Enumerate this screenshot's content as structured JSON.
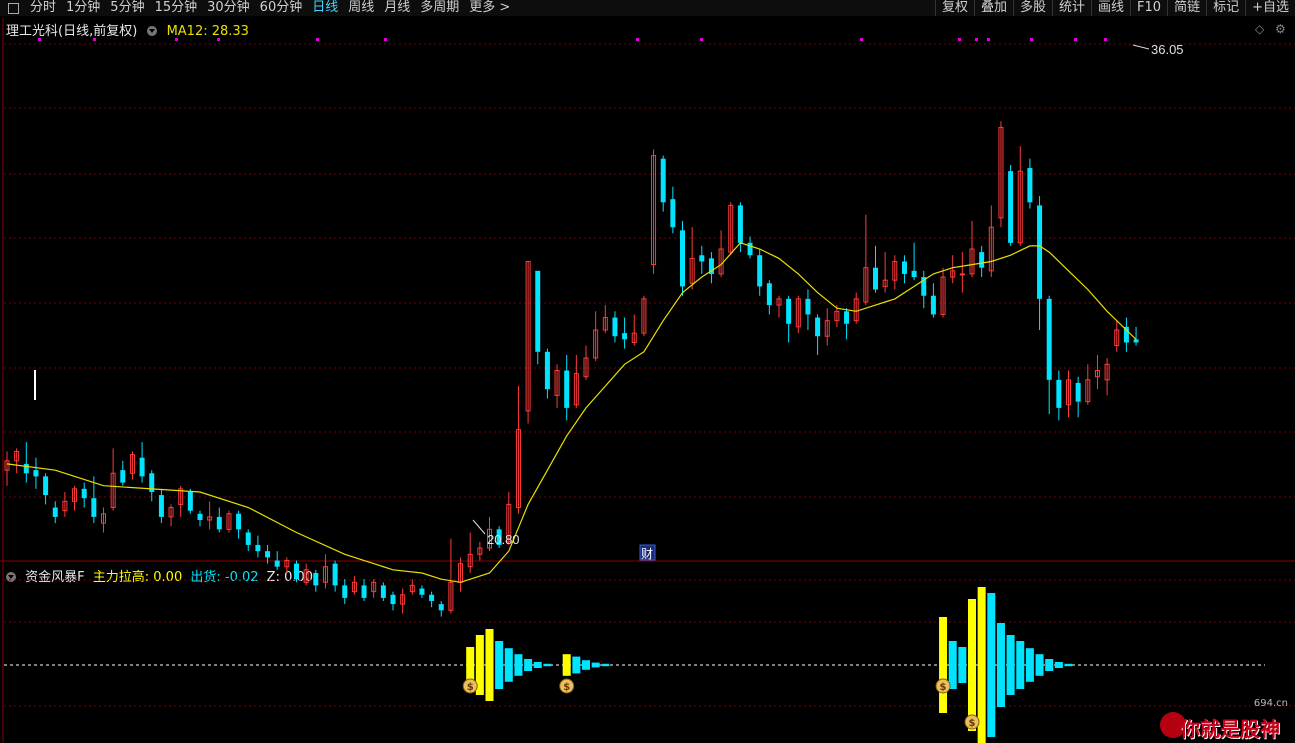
{
  "toolbar": {
    "periods": [
      "分时",
      "1分钟",
      "5分钟",
      "15分钟",
      "30分钟",
      "60分钟",
      "日线",
      "周线",
      "月线",
      "多周期",
      "更多 >"
    ],
    "active_period": "日线",
    "right_buttons": [
      "复权",
      "叠加",
      "多股",
      "统计",
      "画线",
      "F10",
      "简链",
      "标记",
      "+自选"
    ]
  },
  "main_chart": {
    "stock_title": "理工光科(日线,前复权)",
    "ma_label": "MA12: 28.33",
    "high_mark": "36.05",
    "low_mark": "20.80",
    "event_badge": "财"
  },
  "indicator": {
    "name": "资金风暴F",
    "l1": "主力拉高: 0.00",
    "l2": "出货: -0.02",
    "l3": "Z: 0.00"
  },
  "watermark": {
    "site": "694.cn",
    "text": "你就是股神"
  },
  "colors": {
    "up": "#ff3b3b",
    "down": "#00e4ff",
    "ma": "#e8e000",
    "grid": "#7a0000",
    "yellow": "#ffff00",
    "cyan": "#00e4ff"
  },
  "chart_data": {
    "type": "candlestick",
    "y_high": 36.05,
    "y_low": 20.8,
    "ma12_last": 28.33,
    "candles": [
      [
        0,
        22.4,
        22.7,
        21.9,
        23.0
      ],
      [
        1,
        22.7,
        23.0,
        22.3,
        23.1
      ],
      [
        2,
        22.6,
        22.3,
        22.0,
        23.3
      ],
      [
        3,
        22.4,
        22.2,
        21.8,
        22.8
      ],
      [
        4,
        22.2,
        21.6,
        21.3,
        22.3
      ],
      [
        5,
        21.2,
        20.9,
        20.7,
        21.4
      ],
      [
        6,
        21.1,
        21.4,
        20.9,
        21.7
      ],
      [
        7,
        21.4,
        21.8,
        21.1,
        21.9
      ],
      [
        8,
        21.8,
        21.5,
        21.2,
        22.0
      ],
      [
        9,
        21.5,
        20.9,
        20.7,
        22.2
      ],
      [
        10,
        20.7,
        21.0,
        20.4,
        21.2
      ],
      [
        11,
        21.2,
        22.3,
        21.1,
        23.1
      ],
      [
        12,
        22.4,
        22.0,
        21.9,
        22.7
      ],
      [
        13,
        22.3,
        22.9,
        22.1,
        23.0
      ],
      [
        14,
        22.8,
        22.2,
        22.0,
        23.3
      ],
      [
        15,
        22.3,
        21.7,
        21.4,
        22.4
      ],
      [
        16,
        21.6,
        20.9,
        20.7,
        21.8
      ],
      [
        17,
        20.9,
        21.2,
        20.6,
        21.3
      ],
      [
        18,
        21.3,
        21.8,
        20.9,
        21.9
      ],
      [
        19,
        21.7,
        21.1,
        21.0,
        21.8
      ],
      [
        20,
        21.0,
        20.8,
        20.6,
        21.1
      ],
      [
        21,
        20.8,
        20.9,
        20.5,
        21.4
      ],
      [
        22,
        20.9,
        20.5,
        20.4,
        21.2
      ],
      [
        23,
        20.5,
        21.0,
        20.4,
        21.1
      ],
      [
        24,
        21.0,
        20.5,
        20.2,
        21.1
      ],
      [
        25,
        20.4,
        20.0,
        19.8,
        20.5
      ],
      [
        26,
        20.0,
        19.8,
        19.6,
        20.3
      ],
      [
        27,
        19.8,
        19.6,
        19.4,
        20.0
      ],
      [
        28,
        19.5,
        19.3,
        19.2,
        19.8
      ],
      [
        29,
        19.3,
        19.5,
        19.1,
        19.6
      ],
      [
        30,
        19.4,
        18.9,
        18.8,
        19.5
      ],
      [
        31,
        18.8,
        19.2,
        18.7,
        19.4
      ],
      [
        32,
        19.1,
        18.7,
        18.5,
        19.2
      ],
      [
        33,
        18.8,
        19.3,
        18.6,
        19.7
      ],
      [
        34,
        19.4,
        18.7,
        18.5,
        19.5
      ],
      [
        35,
        18.7,
        18.3,
        18.1,
        18.9
      ],
      [
        36,
        18.5,
        18.8,
        18.4,
        19.0
      ],
      [
        37,
        18.7,
        18.3,
        18.2,
        18.9
      ],
      [
        38,
        18.5,
        18.8,
        18.3,
        18.9
      ],
      [
        39,
        18.7,
        18.3,
        18.2,
        18.8
      ],
      [
        40,
        18.4,
        18.1,
        17.9,
        18.5
      ],
      [
        41,
        18.1,
        18.4,
        17.8,
        18.6
      ],
      [
        42,
        18.5,
        18.7,
        18.4,
        18.9
      ],
      [
        43,
        18.6,
        18.4,
        18.3,
        18.7
      ],
      [
        44,
        18.4,
        18.2,
        18.0,
        18.5
      ],
      [
        45,
        18.1,
        17.9,
        17.7,
        18.2
      ],
      [
        46,
        17.9,
        18.8,
        17.8,
        20.2
      ],
      [
        47,
        18.8,
        19.4,
        18.5,
        19.6
      ],
      [
        48,
        19.3,
        19.7,
        19.1,
        20.4
      ],
      [
        49,
        19.7,
        19.9,
        19.5,
        20.1
      ],
      [
        50,
        19.9,
        20.5,
        19.8,
        20.9
      ],
      [
        51,
        20.5,
        20.0,
        19.9,
        20.6
      ],
      [
        52,
        20.1,
        21.3,
        20.0,
        21.7
      ],
      [
        53,
        21.2,
        23.7,
        21.0,
        25.1
      ],
      [
        54,
        24.3,
        29.1,
        23.9,
        29.1
      ],
      [
        55,
        28.8,
        26.2,
        25.8,
        28.0
      ],
      [
        56,
        26.2,
        25.0,
        24.7,
        26.3
      ],
      [
        57,
        24.8,
        25.6,
        24.4,
        25.8
      ],
      [
        58,
        25.6,
        24.4,
        24.0,
        26.1
      ],
      [
        59,
        24.5,
        25.5,
        24.4,
        26.1
      ],
      [
        60,
        25.4,
        26.0,
        25.3,
        26.4
      ],
      [
        61,
        26.0,
        26.9,
        25.9,
        27.5
      ],
      [
        62,
        26.9,
        27.3,
        26.8,
        27.7
      ],
      [
        63,
        27.3,
        26.7,
        26.5,
        27.5
      ],
      [
        64,
        26.8,
        26.6,
        26.3,
        27.3
      ],
      [
        65,
        26.5,
        26.8,
        26.4,
        27.4
      ],
      [
        66,
        26.8,
        27.9,
        26.7,
        28.0
      ],
      [
        67,
        29.0,
        32.5,
        28.7,
        32.7
      ],
      [
        68,
        32.4,
        31.0,
        30.7,
        32.5
      ],
      [
        69,
        31.1,
        30.2,
        30.0,
        31.5
      ],
      [
        70,
        30.1,
        28.3,
        28.0,
        30.4
      ],
      [
        71,
        28.4,
        29.2,
        28.2,
        30.2
      ],
      [
        72,
        29.3,
        29.1,
        28.7,
        29.6
      ],
      [
        73,
        29.2,
        28.7,
        28.4,
        29.4
      ],
      [
        74,
        28.7,
        29.5,
        28.6,
        30.1
      ],
      [
        75,
        29.4,
        30.9,
        29.3,
        31.0
      ],
      [
        76,
        30.9,
        29.7,
        29.4,
        31.0
      ],
      [
        77,
        29.7,
        29.3,
        29.2,
        29.9
      ],
      [
        78,
        29.3,
        28.3,
        28.0,
        29.5
      ],
      [
        79,
        28.4,
        27.7,
        27.4,
        28.5
      ],
      [
        80,
        27.7,
        27.9,
        27.3,
        28.0
      ],
      [
        81,
        27.9,
        27.1,
        26.5,
        28.0
      ],
      [
        82,
        27.0,
        27.9,
        26.8,
        28.0
      ],
      [
        83,
        27.9,
        27.4,
        26.9,
        28.2
      ],
      [
        84,
        27.3,
        26.7,
        26.1,
        27.4
      ],
      [
        85,
        26.7,
        27.2,
        26.4,
        27.6
      ],
      [
        86,
        27.2,
        27.5,
        27.0,
        27.7
      ],
      [
        87,
        27.5,
        27.1,
        26.6,
        27.6
      ],
      [
        88,
        27.2,
        27.9,
        27.1,
        28.1
      ],
      [
        89,
        27.8,
        28.9,
        27.7,
        30.6
      ],
      [
        90,
        28.9,
        28.2,
        28.1,
        29.6
      ],
      [
        91,
        28.3,
        28.5,
        28.1,
        29.4
      ],
      [
        92,
        28.5,
        29.1,
        28.2,
        29.3
      ],
      [
        93,
        29.1,
        28.7,
        28.4,
        29.3
      ],
      [
        94,
        28.8,
        28.6,
        28.5,
        29.7
      ],
      [
        95,
        28.6,
        28.0,
        27.6,
        28.8
      ],
      [
        96,
        28.0,
        27.4,
        27.3,
        28.4
      ],
      [
        97,
        27.4,
        28.6,
        27.3,
        28.9
      ],
      [
        98,
        28.6,
        28.8,
        28.4,
        29.3
      ],
      [
        99,
        28.7,
        28.7,
        28.1,
        29.4
      ],
      [
        100,
        28.7,
        29.5,
        28.6,
        30.4
      ],
      [
        101,
        29.4,
        28.9,
        28.6,
        29.6
      ],
      [
        102,
        28.8,
        30.2,
        28.6,
        30.9
      ],
      [
        103,
        30.5,
        33.4,
        30.2,
        33.6
      ],
      [
        104,
        32.0,
        29.7,
        29.6,
        32.2
      ],
      [
        105,
        29.7,
        32.0,
        29.6,
        32.8
      ],
      [
        106,
        32.1,
        31.0,
        30.8,
        32.4
      ],
      [
        107,
        30.9,
        27.9,
        26.9,
        31.2
      ],
      [
        108,
        27.9,
        25.3,
        24.2,
        28.0
      ],
      [
        109,
        25.3,
        24.4,
        24.0,
        25.6
      ],
      [
        110,
        24.5,
        25.3,
        24.1,
        25.6
      ],
      [
        111,
        25.2,
        24.6,
        24.1,
        25.4
      ],
      [
        112,
        24.6,
        25.3,
        24.5,
        25.8
      ],
      [
        113,
        25.4,
        25.6,
        25.0,
        26.1
      ],
      [
        114,
        25.3,
        25.8,
        24.8,
        26.0
      ],
      [
        115,
        26.4,
        26.9,
        26.2,
        27.2
      ],
      [
        116,
        27.0,
        26.5,
        26.2,
        27.3
      ],
      [
        117,
        26.6,
        26.5,
        26.4,
        27.0
      ]
    ],
    "ma12": [
      [
        0,
        22.6
      ],
      [
        5,
        22.4
      ],
      [
        10,
        21.9
      ],
      [
        15,
        21.8
      ],
      [
        20,
        21.7
      ],
      [
        25,
        21.2
      ],
      [
        30,
        20.4
      ],
      [
        35,
        19.7
      ],
      [
        40,
        19.2
      ],
      [
        43,
        19.1
      ],
      [
        45,
        18.9
      ],
      [
        47,
        18.8
      ],
      [
        50,
        19.1
      ],
      [
        52,
        19.8
      ],
      [
        54,
        21.3
      ],
      [
        56,
        22.4
      ],
      [
        58,
        23.5
      ],
      [
        60,
        24.4
      ],
      [
        62,
        25.1
      ],
      [
        64,
        25.8
      ],
      [
        66,
        26.2
      ],
      [
        68,
        27.2
      ],
      [
        70,
        28.1
      ],
      [
        72,
        28.6
      ],
      [
        74,
        29.0
      ],
      [
        76,
        29.7
      ],
      [
        78,
        29.5
      ],
      [
        80,
        29.2
      ],
      [
        82,
        28.7
      ],
      [
        84,
        28.1
      ],
      [
        86,
        27.6
      ],
      [
        88,
        27.5
      ],
      [
        90,
        27.7
      ],
      [
        92,
        27.9
      ],
      [
        94,
        28.3
      ],
      [
        96,
        28.7
      ],
      [
        98,
        28.9
      ],
      [
        100,
        29.0
      ],
      [
        102,
        29.1
      ],
      [
        104,
        29.3
      ],
      [
        106,
        29.6
      ],
      [
        107,
        29.6
      ],
      [
        108,
        29.4
      ],
      [
        110,
        28.8
      ],
      [
        112,
        28.2
      ],
      [
        114,
        27.5
      ],
      [
        116,
        26.9
      ],
      [
        117,
        26.6
      ]
    ],
    "indicator_bars": [
      [
        48,
        0.3,
        "y"
      ],
      [
        49,
        0.5,
        "y"
      ],
      [
        50,
        0.6,
        "y"
      ],
      [
        51,
        0.4,
        "c"
      ],
      [
        52,
        0.28,
        "c"
      ],
      [
        53,
        0.18,
        "c"
      ],
      [
        54,
        0.1,
        "c"
      ],
      [
        55,
        0.05,
        "c"
      ],
      [
        56,
        0.02,
        "c"
      ],
      [
        58,
        0.18,
        "y"
      ],
      [
        59,
        0.14,
        "c"
      ],
      [
        60,
        0.08,
        "c"
      ],
      [
        61,
        0.04,
        "c"
      ],
      [
        62,
        0.02,
        "c"
      ],
      [
        97,
        0.8,
        "y"
      ],
      [
        98,
        0.4,
        "c"
      ],
      [
        99,
        0.3,
        "c"
      ],
      [
        100,
        1.1,
        "y"
      ],
      [
        101,
        1.3,
        "y"
      ],
      [
        102,
        1.2,
        "c"
      ],
      [
        103,
        0.7,
        "c"
      ],
      [
        104,
        0.5,
        "c"
      ],
      [
        105,
        0.4,
        "c"
      ],
      [
        106,
        0.28,
        "c"
      ],
      [
        107,
        0.18,
        "c"
      ],
      [
        108,
        0.1,
        "c"
      ],
      [
        109,
        0.05,
        "c"
      ],
      [
        110,
        0.02,
        "c"
      ]
    ],
    "coin_markers": [
      48,
      58,
      97,
      100
    ]
  }
}
